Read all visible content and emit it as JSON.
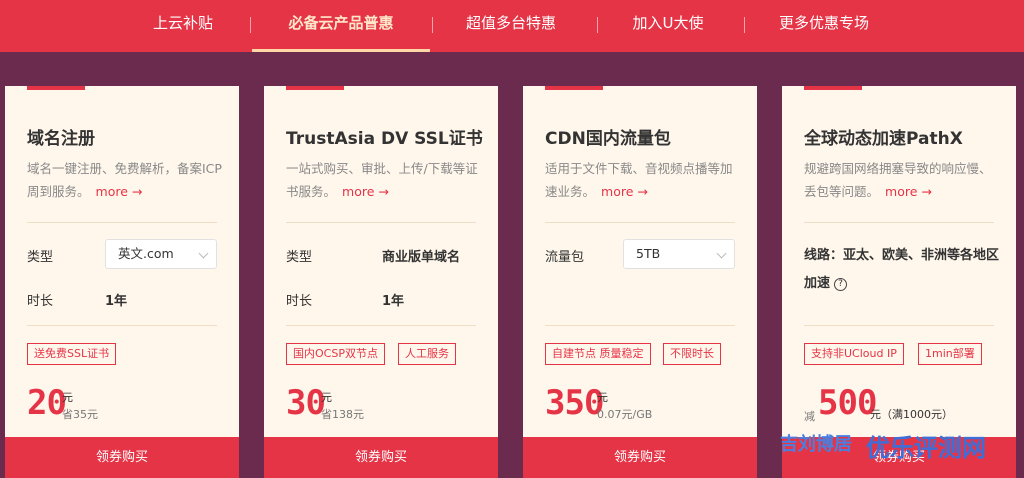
{
  "nav": [
    {
      "label": "上云补贴"
    },
    {
      "label": "必备云产品普惠"
    },
    {
      "label": "超值多台特惠"
    },
    {
      "label": "加入U大使"
    },
    {
      "label": "更多优惠专场"
    }
  ],
  "colors": {
    "brand_red": "#e63447",
    "bg_purple": "#6a2b4f",
    "card_bg": "#fff7ec"
  },
  "cards": [
    {
      "title": "域名注册",
      "desc": "域名一键注册、免费解析，备案ICP周到服务。",
      "more": "more →",
      "type_label": "类型",
      "type_select": "英文.com",
      "duration_label": "时长",
      "duration_value": "1年",
      "tags": [
        "送免费SSL证书"
      ],
      "price": "20",
      "unit": "元",
      "sub": "省35元",
      "buy": "领券购买"
    },
    {
      "title": "TrustAsia DV SSL证书",
      "desc": "一站式购买、审批、上传/下载等证书服务。",
      "more": "more →",
      "type_label": "类型",
      "type_value": "商业版单域名",
      "duration_label": "时长",
      "duration_value": "1年",
      "tags": [
        "国内OCSP双节点",
        "人工服务"
      ],
      "price": "30",
      "unit": "元",
      "sub": "省138元",
      "buy": "领券购买"
    },
    {
      "title": "CDN国内流量包",
      "desc": "适用于文件下载、音视频点播等加速业务。",
      "more": "more →",
      "pkg_label": "流量包",
      "pkg_select": "5TB",
      "tags": [
        "自建节点 质量稳定",
        "不限时长"
      ],
      "price": "350",
      "unit": "元",
      "sub": "0.07元/GB",
      "buy": "领券购买"
    },
    {
      "title": "全球动态加速PathX",
      "desc": "规避跨国网络拥塞导致的响应慢、丢包等问题。",
      "more": "more →",
      "line": "线路：亚太、欧美、非洲等各地区加速",
      "help": "?",
      "tags": [
        "支持非UCloud IP",
        "1min部署"
      ],
      "prefix": "减",
      "price": "500",
      "unit": "元（满1000元）",
      "buy": "领券购买"
    }
  ],
  "watermark": {
    "left": "吉刘博居",
    "right": "优乐评测网"
  }
}
